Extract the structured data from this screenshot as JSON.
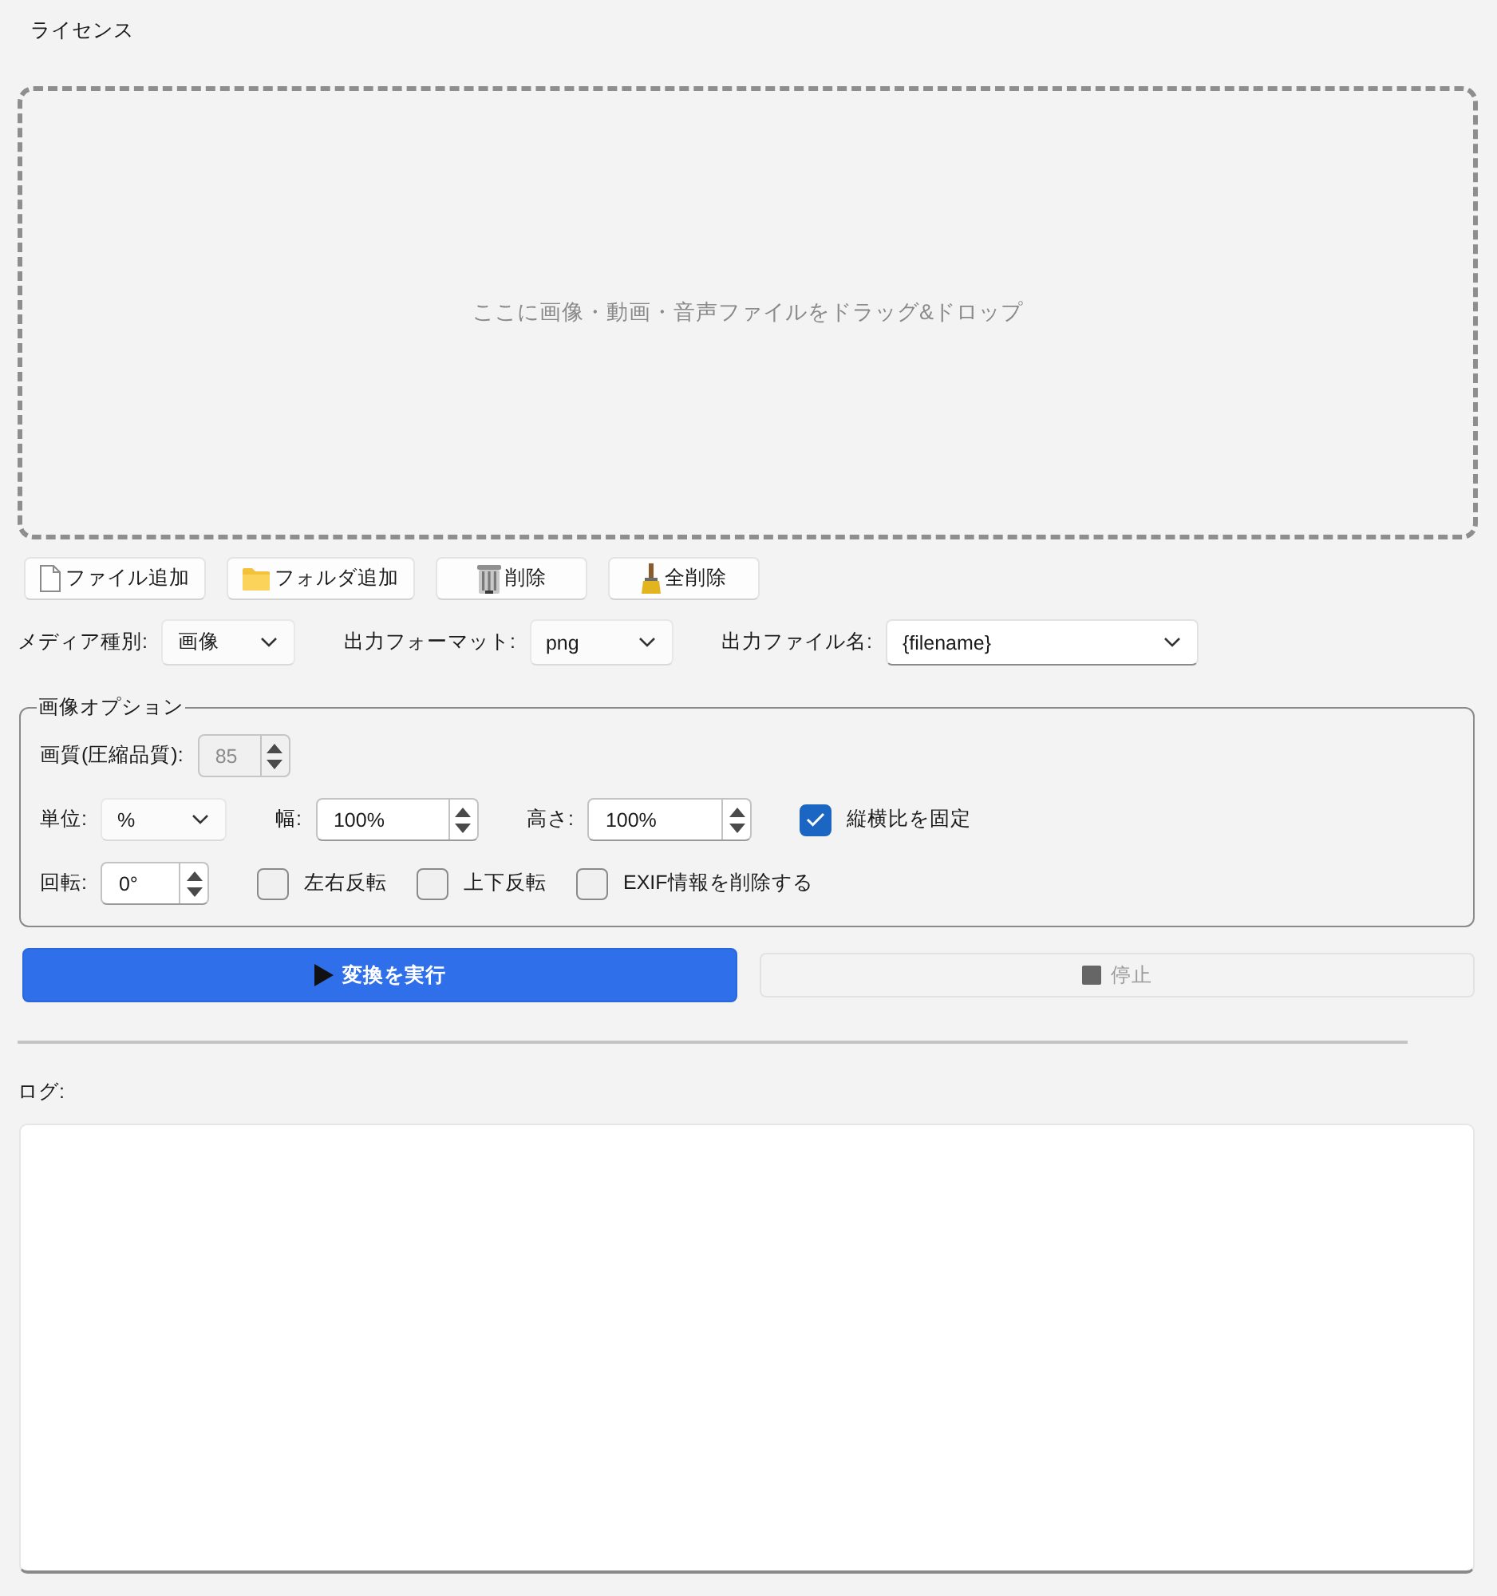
{
  "menu": [
    {
      "label": "ライセンス"
    }
  ],
  "drop_zone": {
    "text": "ここに画像・動画・音声ファイルをドラッグ&ドロップ"
  },
  "file_buttons": [
    {
      "kind": "file",
      "label": "ファイル追加"
    },
    {
      "kind": "folder",
      "label": "フォルダ追加"
    },
    {
      "kind": "trash",
      "label": "削除"
    },
    {
      "kind": "broom",
      "label": "全削除"
    }
  ],
  "settings": [
    {
      "label": "メディア種別:",
      "value": "画像",
      "editable": false
    },
    {
      "label": "出力フォーマット:",
      "value": "png",
      "editable": false
    },
    {
      "label": "出力ファイル名:",
      "value": "{filename}",
      "editable": true
    }
  ],
  "image_options": {
    "title": "画像オプション",
    "rows": [
      [
        {
          "kind": "spin",
          "label": "画質(圧縮品質):",
          "value": "85",
          "disabled": true
        }
      ],
      [
        {
          "kind": "combo",
          "label": "単位:",
          "value": "%"
        },
        {
          "kind": "spin",
          "label": "幅:",
          "value": "100%",
          "disabled": false
        },
        {
          "kind": "spin",
          "label": "高さ:",
          "value": "100%",
          "disabled": false
        },
        {
          "kind": "checkbox",
          "label": "縦横比を固定",
          "checked": true
        }
      ],
      [
        {
          "kind": "spin",
          "label": "回転:",
          "value": "0°",
          "disabled": false
        },
        {
          "kind": "checkbox",
          "label": "左右反転",
          "checked": false
        },
        {
          "kind": "checkbox",
          "label": "上下反転",
          "checked": false
        },
        {
          "kind": "checkbox",
          "label": "EXIF情報を削除する",
          "checked": false
        }
      ]
    ]
  },
  "actions": [
    {
      "kind": "run",
      "label": "変換を実行",
      "disabled": false
    },
    {
      "kind": "stop",
      "label": "停止",
      "disabled": true
    }
  ],
  "log": {
    "label": "ログ:"
  }
}
